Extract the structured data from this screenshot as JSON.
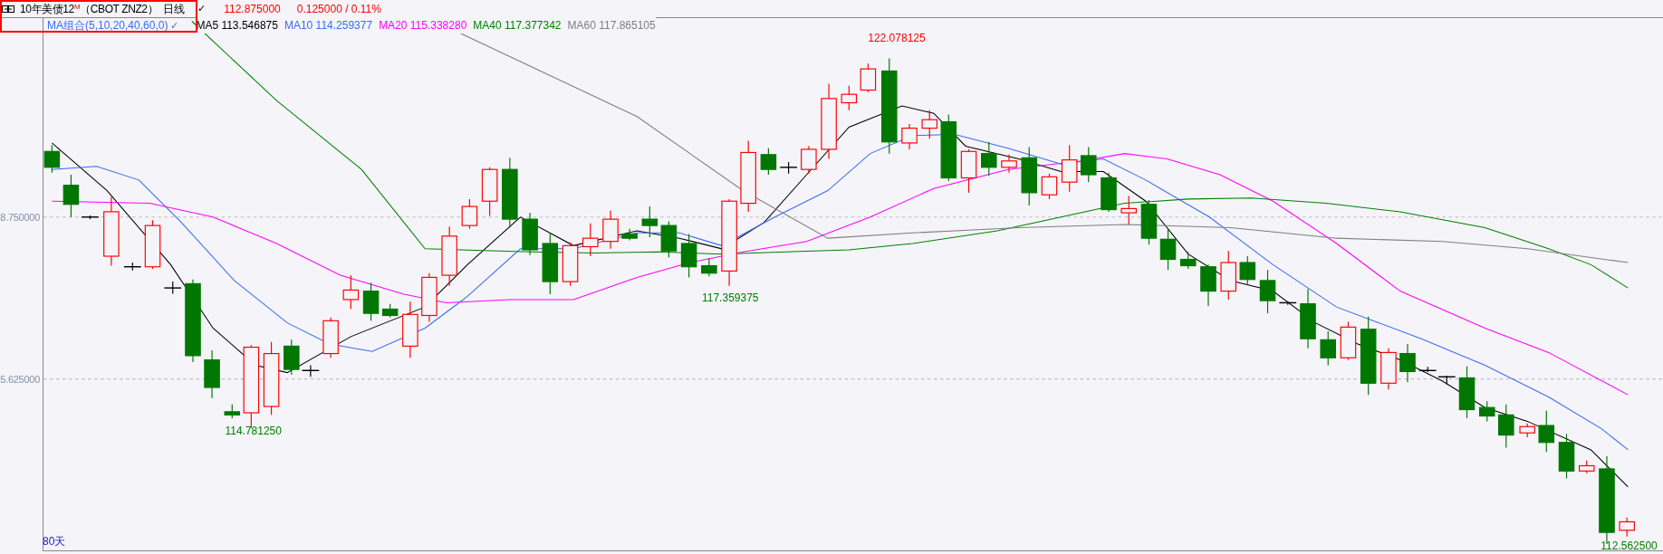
{
  "header": {
    "instrument": "10年美债12$^{M}$（CBOT ZNZ2）",
    "period": "日线",
    "period_check": "✓",
    "last_price": "112.875000",
    "change": "0.125000 / 0.11%"
  },
  "indicator_bar": {
    "preset": "MA组合(5,10,20,40,60,0)",
    "check": "✓",
    "lines": [
      {
        "label": "MA5 113.546875",
        "color": "#000000"
      },
      {
        "label": "MA10 114.259377",
        "color": "#3b6cf0"
      },
      {
        "label": "MA20 115.338280",
        "color": "#ff00ff"
      },
      {
        "label": "MA40 117.377342",
        "color": "#008000"
      },
      {
        "label": "MA60 117.865105",
        "color": "#808080"
      }
    ]
  },
  "axis": {
    "yticks": [
      "8.750000",
      "5.625000"
    ]
  },
  "price_labels": [
    {
      "text": "122.078125",
      "kind": "high"
    },
    {
      "text": "117.359375",
      "kind": "low"
    },
    {
      "text": "114.781250",
      "kind": "low"
    },
    {
      "text": "112.562500",
      "kind": "last"
    }
  ],
  "range_label": "80天"
}
